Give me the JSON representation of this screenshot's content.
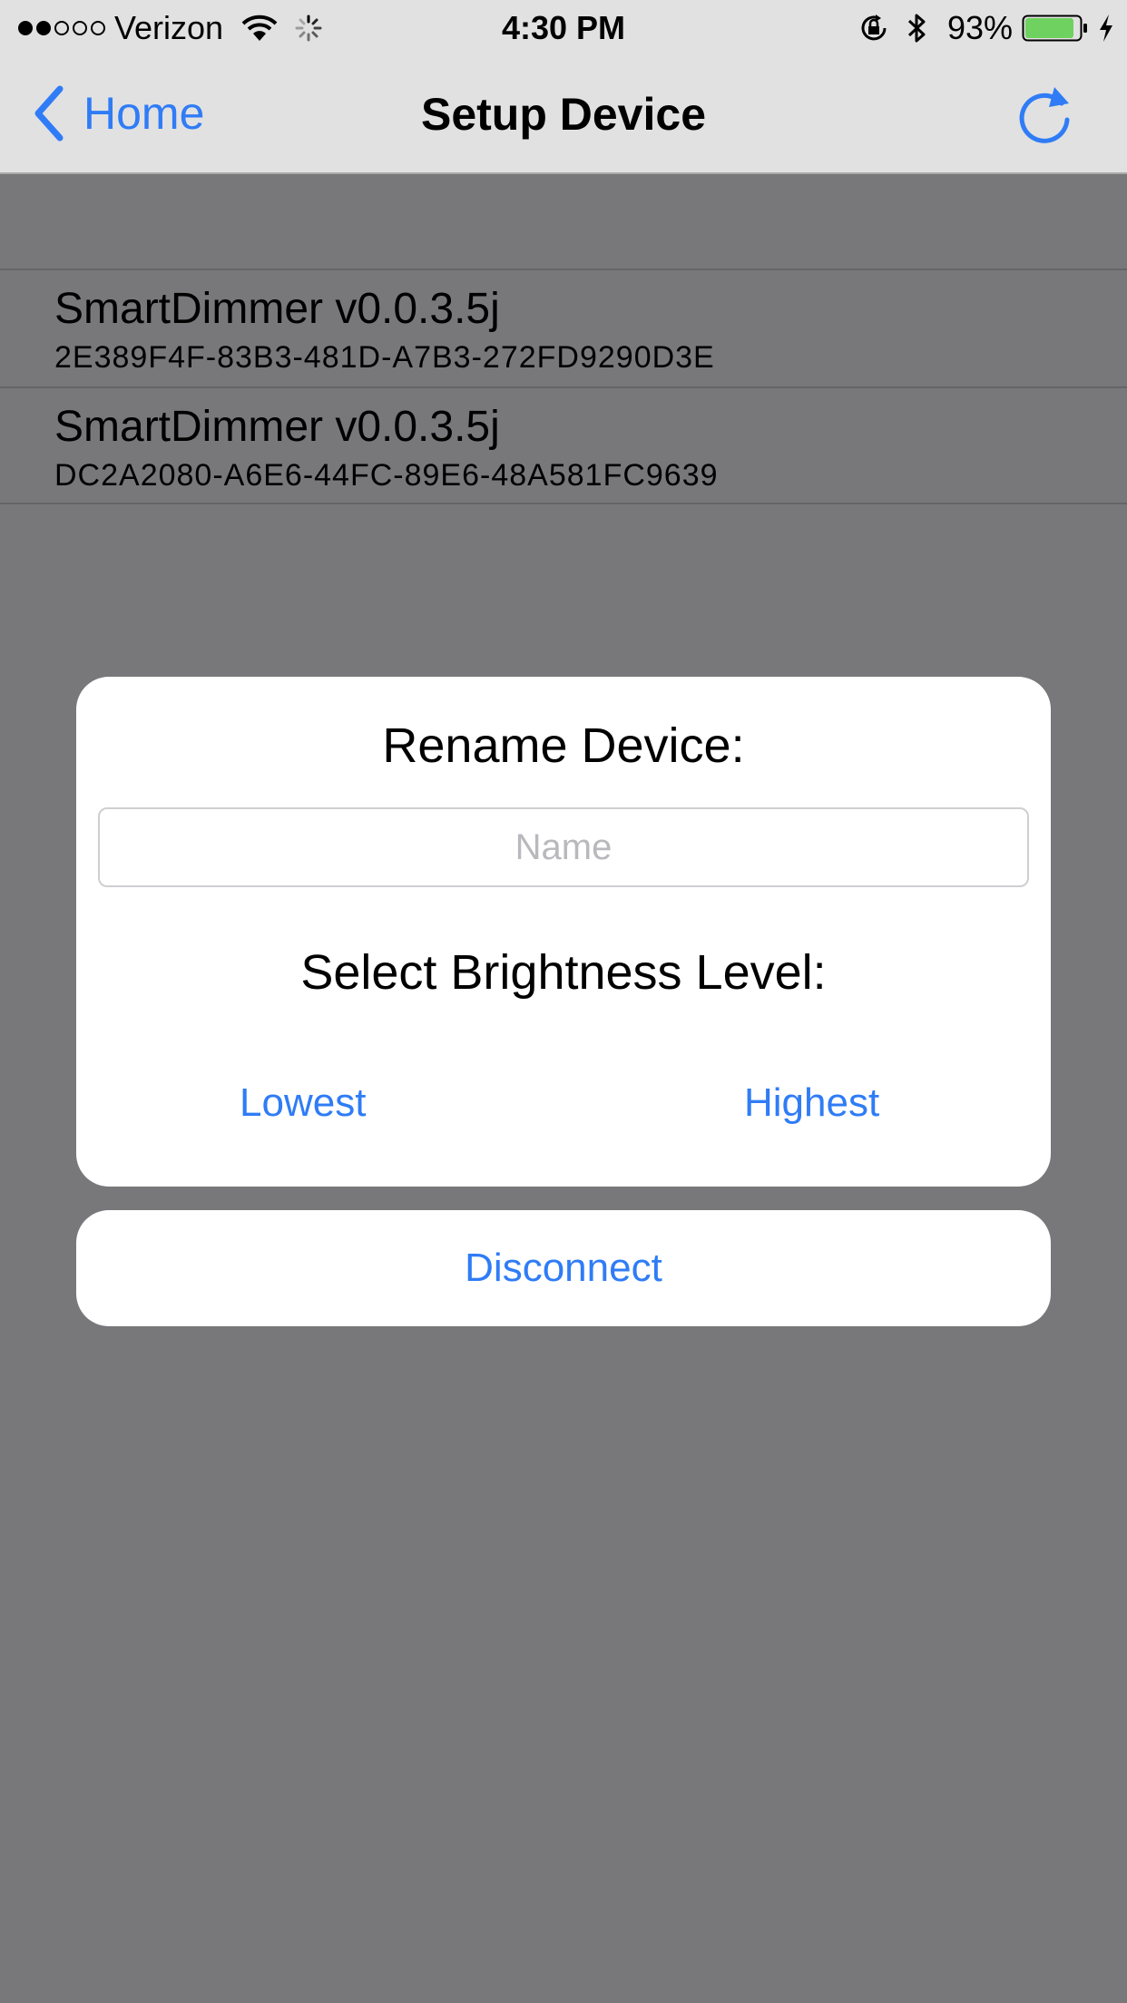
{
  "status_bar": {
    "signal_dots_filled": 2,
    "signal_dots_total": 5,
    "carrier": "Verizon",
    "time": "4:30 PM",
    "battery_percent": "93%",
    "battery_color": "#6fd15f",
    "icons": [
      "wifi-icon",
      "activity-spinner-icon",
      "orientation-lock-icon",
      "bluetooth-icon",
      "battery-icon",
      "charging-bolt-icon"
    ]
  },
  "nav": {
    "back_label": "Home",
    "title": "Setup Device",
    "refresh_icon": "refresh-icon"
  },
  "devices": [
    {
      "name": "SmartDimmer v0.0.3.5j",
      "uuid": "2E389F4F-83B3-481D-A7B3-272FD9290D3E"
    },
    {
      "name": "SmartDimmer v0.0.3.5j",
      "uuid": "DC2A2080-A6E6-44FC-89E6-48A581FC9639"
    }
  ],
  "alert": {
    "title": "Rename Device:",
    "name_placeholder": "Name",
    "name_value": "",
    "brightness_label": "Select Brightness Level:",
    "lowest_label": "Lowest",
    "highest_label": "Highest"
  },
  "disconnect_label": "Disconnect",
  "colors": {
    "accent": "#2f7cf6",
    "overlay": "#78787b",
    "bar_background": "#e1e1e1"
  }
}
